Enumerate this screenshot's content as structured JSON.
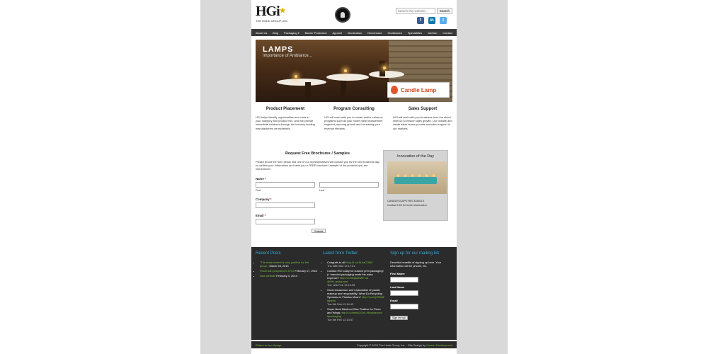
{
  "header": {
    "logo_text": "HGi",
    "logo_subtitle": "THE HODE GROUP, INC.",
    "search_placeholder": "Search this website...",
    "search_button": "Search"
  },
  "nav": [
    "About Us",
    "Blog",
    "Packaging ▾",
    "Barrier Protection",
    "Apparel",
    "Illumination",
    "Dinnerware",
    "Smallwares",
    "Specialities",
    "JanSan",
    "Contact"
  ],
  "banner": {
    "title": "LAMPS",
    "subtitle": "Importance of Ambiance...",
    "brand": "Candle Lamp"
  },
  "columns": [
    {
      "heading": "Product Placement",
      "text": "HGi helps identify opportunities and voids in your category and product mix, and will provide immediate solutions through the industry-leading manufacturers we represent."
    },
    {
      "heading": "Program Consulting",
      "text": "HGi will meet with you to create and/or enhance programs such as your home meal replacement segment, spurring growth and increasing your revenue streams."
    },
    {
      "heading": "Sales Support",
      "text": "HGi will work with your business from the street level up to ensure sales growth. Our outside and inside sales teams provide unrivaled support in our markets."
    }
  ],
  "form": {
    "heading": "Request Free Brochures / Samples",
    "intro": "Please fill out the form below and one of our representatives will contact you by the next business day to confirm your information and send you a FREE brochure / sample of the products you are interested in.",
    "name_label": "Name",
    "first_label": "First",
    "last_label": "Last",
    "company_label": "Company",
    "email_label": "Email",
    "required_mark": "*",
    "submit": "Submit"
  },
  "innovation": {
    "heading": "Innovation of the Day",
    "product": "CANDLESCAPE RECTANGLE",
    "note": "Contact HGi for more information"
  },
  "footer": {
    "recent_posts": {
      "heading": "Recent Posts",
      "items": [
        {
          "link": "\"The environment is very positive for the group,\"",
          "date": "March 28, 2013"
        },
        {
          "link": "Foam ban proposed in NYC",
          "date": "February 17, 2013"
        },
        {
          "link": "New website",
          "date": "February 4, 2013"
        }
      ]
    },
    "twitter": {
      "heading": "Latest from Twitter",
      "items": [
        {
          "text": "Congrats to all!",
          "link": "http://t.co/AL4aCO8N",
          "date": "Thu 28th Mar 13 17:51"
        },
        {
          "text": "Contact HGi today for custom print packaging! (+ branded packaging worth the extra expense?",
          "link": "http://t.co/3q5ANZE",
          "extra": "via @HH_restaurant",
          "date": "Tue 12th Feb 13 13:39"
        },
        {
          "text": "Good breakdown and explanation of plastic makeup and recyclability: What Do Recycling Symbols on Plastics Mean?",
          "link": "http://t.co/cj7ZSdiF #green",
          "date": "Tue 5th Feb 13 14:43"
        },
        {
          "text": "Super Bowl Blackout Was Positive for Pizza and Wings",
          "link": "http://t.co/bwtUJGx4 #foodservice #packaging",
          "date": "Tue 5th Feb 13 13:57"
        }
      ]
    },
    "mailing": {
      "heading": "Sign up for our mailing list",
      "intro": "Describe benefits of signing up here. Your information will be private, etc.",
      "first_name": "First Name",
      "last_name": "Last Name",
      "email": "Email",
      "button": "Sign me up!"
    }
  },
  "bottom_bar": {
    "back_to_top": "Return to top of page",
    "copyright": "Copyright © 2013 The Hode Group, Inc. · Site Design by",
    "designer": "Courier Development"
  }
}
